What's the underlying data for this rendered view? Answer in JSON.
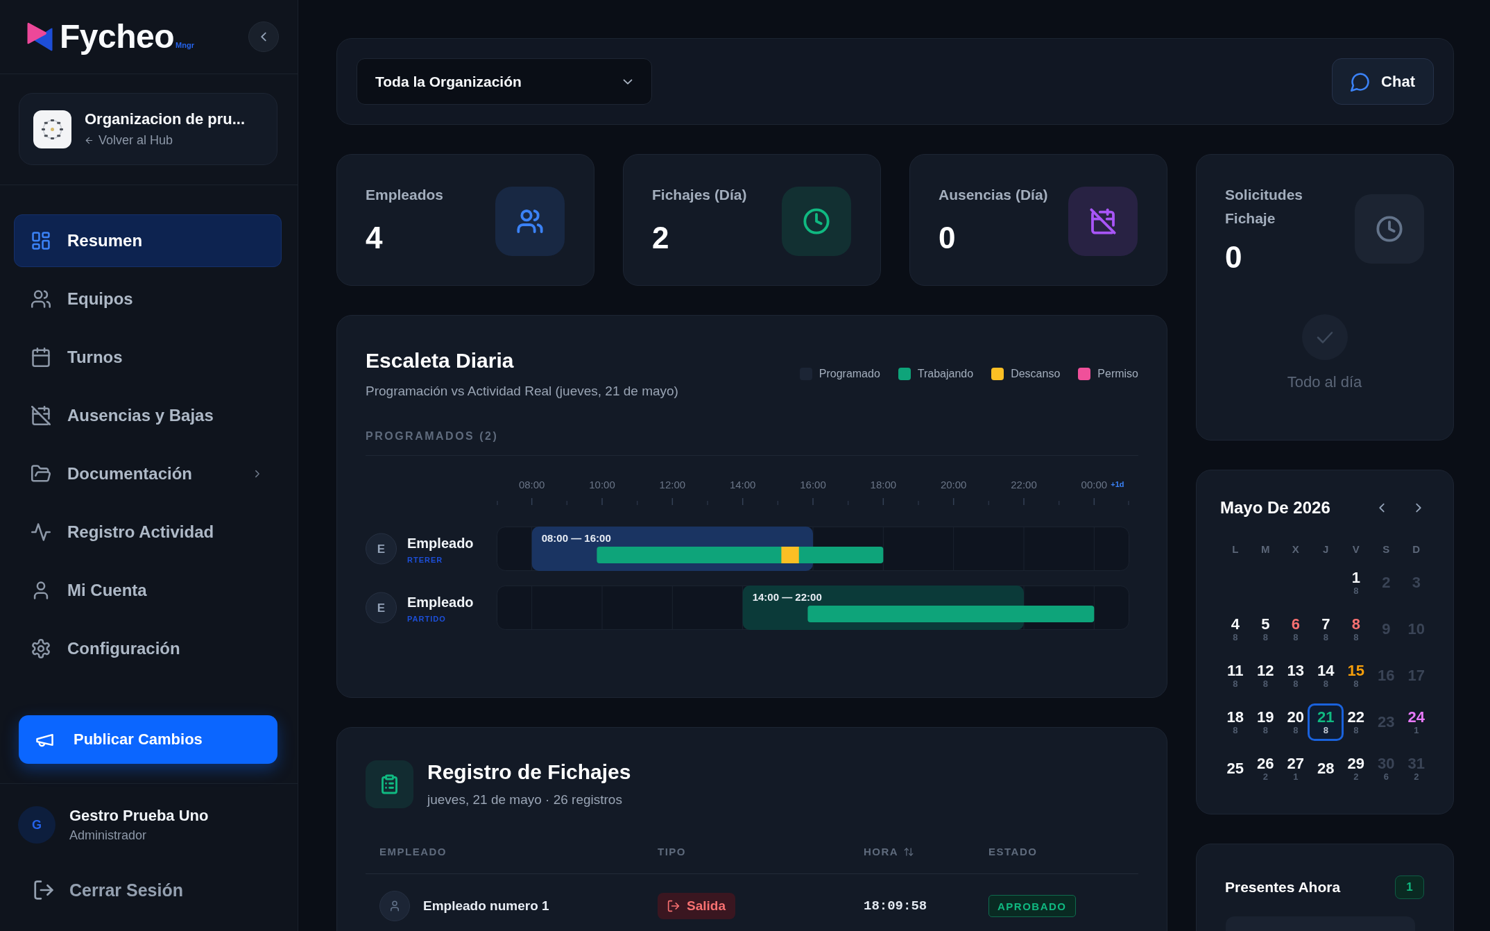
{
  "sidebar": {
    "logo": {
      "name": "Fycheo",
      "suffix": "Mngr"
    },
    "organization": {
      "name": "Organizacion de pru...",
      "back_link": "Volver al Hub"
    },
    "nav": [
      {
        "label": "Resumen",
        "kind": "link",
        "selected": true
      },
      {
        "label": "Equipos",
        "kind": "link",
        "selected": false
      },
      {
        "label": "Turnos",
        "kind": "link",
        "selected": false
      },
      {
        "label": "Ausencias y Bajas",
        "kind": "link",
        "selected": false
      },
      {
        "label": "Documentación",
        "kind": "group",
        "selected": false
      },
      {
        "label": "Registro Actividad",
        "kind": "link",
        "selected": false
      },
      {
        "label": "Mi Cuenta",
        "kind": "link",
        "selected": false
      },
      {
        "label": "Configuración",
        "kind": "link",
        "selected": false
      }
    ],
    "publish_button": "Publicar Cambios",
    "user": {
      "initial": "G",
      "name": "Gestro Prueba Uno",
      "role": "Administrador"
    },
    "logout": "Cerrar Sesión"
  },
  "top_bar": {
    "scope_select": {
      "value": "Toda la Organización"
    },
    "chat_button": "Chat"
  },
  "stats": [
    {
      "label": "Empleados",
      "value": "4",
      "color": "#3b82f6"
    },
    {
      "label": "Fichajes (Día)",
      "value": "2",
      "color": "#10b981"
    },
    {
      "label": "Ausencias (Día)",
      "value": "0",
      "color": "#a855f7"
    }
  ],
  "requests": {
    "label": "Solicitudes Fichaje",
    "value": "0",
    "empty_message": "Todo al día"
  },
  "schedule": {
    "title": "Escaleta Diaria",
    "subtitle": "Programación vs Actividad Real (jueves, 21 de mayo)",
    "legend": [
      {
        "label": "Programado",
        "color": "#1c2535"
      },
      {
        "label": "Trabajando",
        "color": "#0ea47a"
      },
      {
        "label": "Descanso",
        "color": "#fbbf24"
      },
      {
        "label": "Permiso",
        "color": "#f0509a"
      }
    ],
    "section_label": "PROGRAMADOS (2)",
    "axis_labels": [
      "08:00",
      "10:00",
      "12:00",
      "14:00",
      "16:00",
      "18:00",
      "20:00",
      "22:00",
      "00:00"
    ],
    "day_mark": "+1d",
    "rows": [
      {
        "initial": "E",
        "name": "Empleado",
        "shift": "RTERER",
        "shift_label": "08:00 — 16:00",
        "color": "#1a3462"
      },
      {
        "initial": "E",
        "name": "Empleado",
        "shift": "PARTIDO",
        "shift_label": "14:00 — 22:00",
        "color": "#0b3a39"
      }
    ]
  },
  "records": {
    "title": "Registro de Fichajes",
    "subtitle": "jueves, 21 de mayo · 26 registros",
    "columns": [
      {
        "label": "EMPLEADO",
        "sortable": false
      },
      {
        "label": "TIPO",
        "sortable": false
      },
      {
        "label": "HORA",
        "sortable": true
      },
      {
        "label": "ESTADO",
        "sortable": false
      }
    ],
    "rows": [
      {
        "employee": "Empleado numero 1",
        "type": {
          "label": "Salida",
          "kind": "exit"
        },
        "time": "18:09:58",
        "status": {
          "label": "APROBADO",
          "kind": "approved"
        }
      }
    ]
  },
  "calendar": {
    "title": "Mayo De 2026",
    "weekdays": [
      "L",
      "M",
      "X",
      "J",
      "V",
      "S",
      "D"
    ],
    "weeks": [
      [
        {
          "kind": "empty"
        },
        {
          "kind": "empty"
        },
        {
          "kind": "empty"
        },
        {
          "kind": "empty"
        },
        {
          "kind": "day",
          "label": "1",
          "count": "8",
          "color": "#f8fafc",
          "selected": false
        },
        {
          "kind": "day",
          "label": "2",
          "color": "#3a4456",
          "selected": false
        },
        {
          "kind": "day",
          "label": "3",
          "color": "#3a4456",
          "selected": false
        }
      ],
      [
        {
          "kind": "day",
          "label": "4",
          "count": "8",
          "color": "#f8fafc",
          "selected": false
        },
        {
          "kind": "day",
          "label": "5",
          "count": "8",
          "color": "#f8fafc",
          "selected": false
        },
        {
          "kind": "day",
          "label": "6",
          "count": "8",
          "color": "#f87171",
          "selected": false
        },
        {
          "kind": "day",
          "label": "7",
          "count": "8",
          "color": "#f8fafc",
          "selected": false
        },
        {
          "kind": "day",
          "label": "8",
          "count": "8",
          "color": "#f87171",
          "selected": false
        },
        {
          "kind": "day",
          "label": "9",
          "color": "#3a4456",
          "selected": false
        },
        {
          "kind": "day",
          "label": "10",
          "color": "#3a4456",
          "selected": false
        }
      ],
      [
        {
          "kind": "day",
          "label": "11",
          "count": "8",
          "color": "#f8fafc",
          "selected": false
        },
        {
          "kind": "day",
          "label": "12",
          "count": "8",
          "color": "#f8fafc",
          "selected": false
        },
        {
          "kind": "day",
          "label": "13",
          "count": "8",
          "color": "#f8fafc",
          "selected": false
        },
        {
          "kind": "day",
          "label": "14",
          "count": "8",
          "color": "#f8fafc",
          "selected": false
        },
        {
          "kind": "day",
          "label": "15",
          "count": "8",
          "color": "#f59e0b",
          "selected": false
        },
        {
          "kind": "day",
          "label": "16",
          "color": "#3a4456",
          "selected": false
        },
        {
          "kind": "day",
          "label": "17",
          "color": "#3a4456",
          "selected": false
        }
      ],
      [
        {
          "kind": "day",
          "label": "18",
          "count": "8",
          "color": "#f8fafc",
          "selected": false
        },
        {
          "kind": "day",
          "label": "19",
          "count": "8",
          "color": "#f8fafc",
          "selected": false
        },
        {
          "kind": "day",
          "label": "20",
          "count": "8",
          "color": "#f8fafc",
          "selected": false
        },
        {
          "kind": "day",
          "label": "21",
          "count": "8",
          "color": "#10b981",
          "selected": true
        },
        {
          "kind": "day",
          "label": "22",
          "count": "8",
          "color": "#f8fafc",
          "selected": false
        },
        {
          "kind": "day",
          "label": "23",
          "color": "#3a4456",
          "selected": false
        },
        {
          "kind": "day",
          "label": "24",
          "count": "1",
          "color": "#e879f9",
          "selected": false
        }
      ],
      [
        {
          "kind": "day",
          "label": "25",
          "color": "#f8fafc",
          "selected": false
        },
        {
          "kind": "day",
          "label": "26",
          "count": "2",
          "color": "#f8fafc",
          "selected": false
        },
        {
          "kind": "day",
          "label": "27",
          "count": "1",
          "color": "#f8fafc",
          "selected": false
        },
        {
          "kind": "day",
          "label": "28",
          "color": "#f8fafc",
          "selected": false
        },
        {
          "kind": "day",
          "label": "29",
          "count": "2",
          "color": "#f8fafc",
          "selected": false
        },
        {
          "kind": "day",
          "label": "30",
          "count": "6",
          "color": "#3a4456",
          "selected": false
        },
        {
          "kind": "day",
          "label": "31",
          "count": "2",
          "color": "#3a4456",
          "selected": false
        }
      ]
    ]
  },
  "present_now": {
    "title": "Presentes Ahora",
    "count": "1"
  }
}
